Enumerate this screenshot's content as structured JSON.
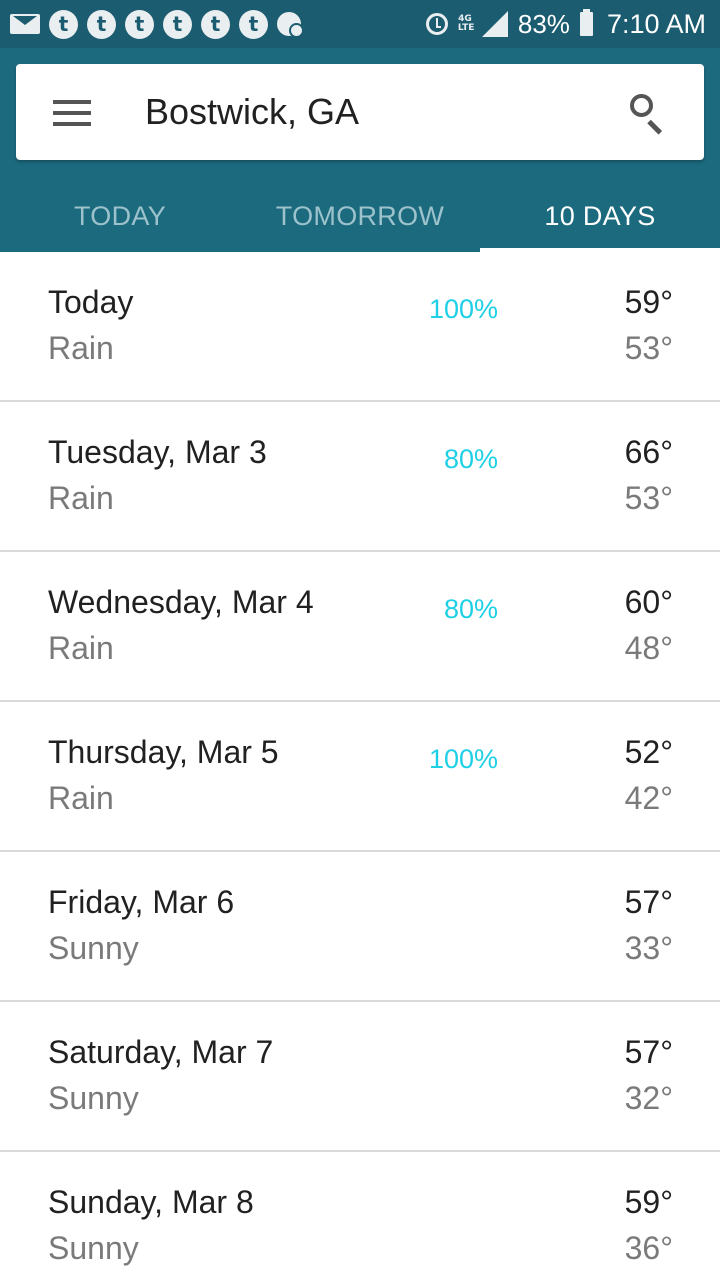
{
  "status_bar": {
    "notification_icons": [
      "mail-icon",
      "t-app-icon",
      "t-app-icon",
      "t-app-icon",
      "t-app-icon",
      "t-app-icon",
      "t-app-icon",
      "chat-icon"
    ],
    "app_icon_glyph": "t",
    "battery_percent": "83%",
    "time": "7:10 AM",
    "network": "4G LTE"
  },
  "search": {
    "location": "Bostwick, GA"
  },
  "tabs": [
    {
      "label": "TODAY",
      "active": false
    },
    {
      "label": "TOMORROW",
      "active": false
    },
    {
      "label": "10 DAYS",
      "active": true
    }
  ],
  "forecast": [
    {
      "day": "Today",
      "condition": "Rain",
      "precip": "100%",
      "high": "59°",
      "low": "53°"
    },
    {
      "day": "Tuesday, Mar 3",
      "condition": "Rain",
      "precip": "80%",
      "high": "66°",
      "low": "53°"
    },
    {
      "day": "Wednesday, Mar 4",
      "condition": "Rain",
      "precip": "80%",
      "high": "60°",
      "low": "48°"
    },
    {
      "day": "Thursday, Mar 5",
      "condition": "Rain",
      "precip": "100%",
      "high": "52°",
      "low": "42°"
    },
    {
      "day": "Friday, Mar 6",
      "condition": "Sunny",
      "precip": "",
      "high": "57°",
      "low": "33°"
    },
    {
      "day": "Saturday, Mar 7",
      "condition": "Sunny",
      "precip": "",
      "high": "57°",
      "low": "32°"
    },
    {
      "day": "Sunday, Mar 8",
      "condition": "Sunny",
      "precip": "",
      "high": "59°",
      "low": "36°"
    }
  ],
  "colors": {
    "status_bar": "#1c5c70",
    "app_bar": "#1c6a7e",
    "precip_accent": "#1ed0e6"
  }
}
